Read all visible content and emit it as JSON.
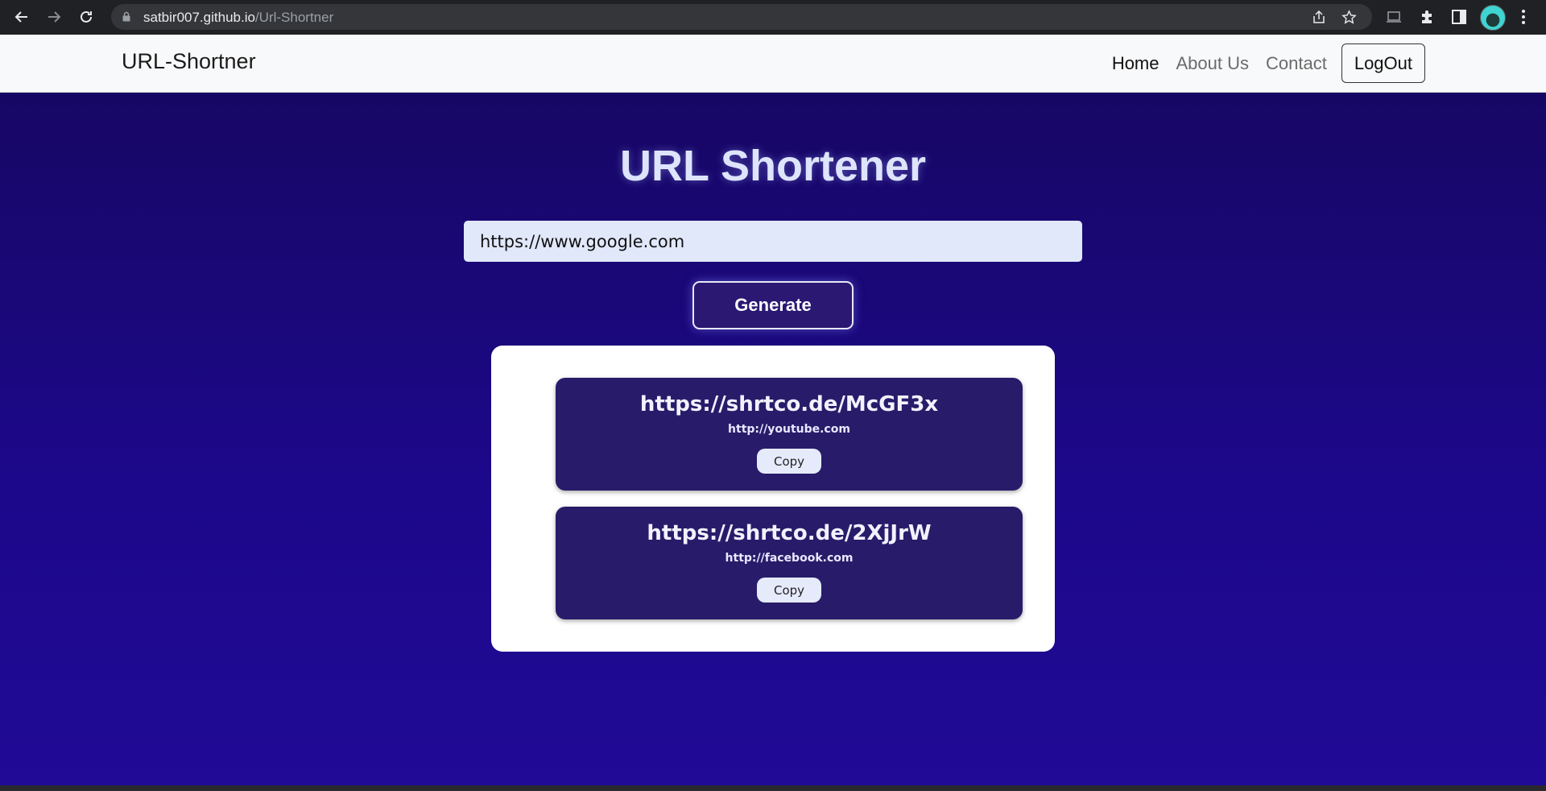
{
  "browser": {
    "url_host": "satbir007.github.io",
    "url_path": "/Url-Shortner",
    "icons": [
      "back-arrow-icon",
      "forward-arrow-icon",
      "reload-icon",
      "lock-icon",
      "share-icon",
      "bookmark-star-icon",
      "cast-icon",
      "extensions-puzzle-icon",
      "side-panel-icon",
      "profile-avatar",
      "more-menu-icon"
    ]
  },
  "navbar": {
    "brand": "URL-Shortner",
    "links": [
      {
        "label": "Home",
        "active": true
      },
      {
        "label": "About Us",
        "active": false
      },
      {
        "label": "Contact",
        "active": false
      }
    ],
    "logout_label": "LogOut"
  },
  "main": {
    "title": "URL Shortener",
    "input_value": "https://www.google.com",
    "generate_label": "Generate",
    "results": [
      {
        "short_url": "https://shrtco.de/McGF3x",
        "original_url": "http://youtube.com",
        "copy_label": "Copy"
      },
      {
        "short_url": "https://shrtco.de/2XjJrW",
        "original_url": "http://facebook.com",
        "copy_label": "Copy"
      }
    ]
  },
  "colors": {
    "background": "#1c088a",
    "card": "#281c6a",
    "input": "#e0e8fa"
  }
}
